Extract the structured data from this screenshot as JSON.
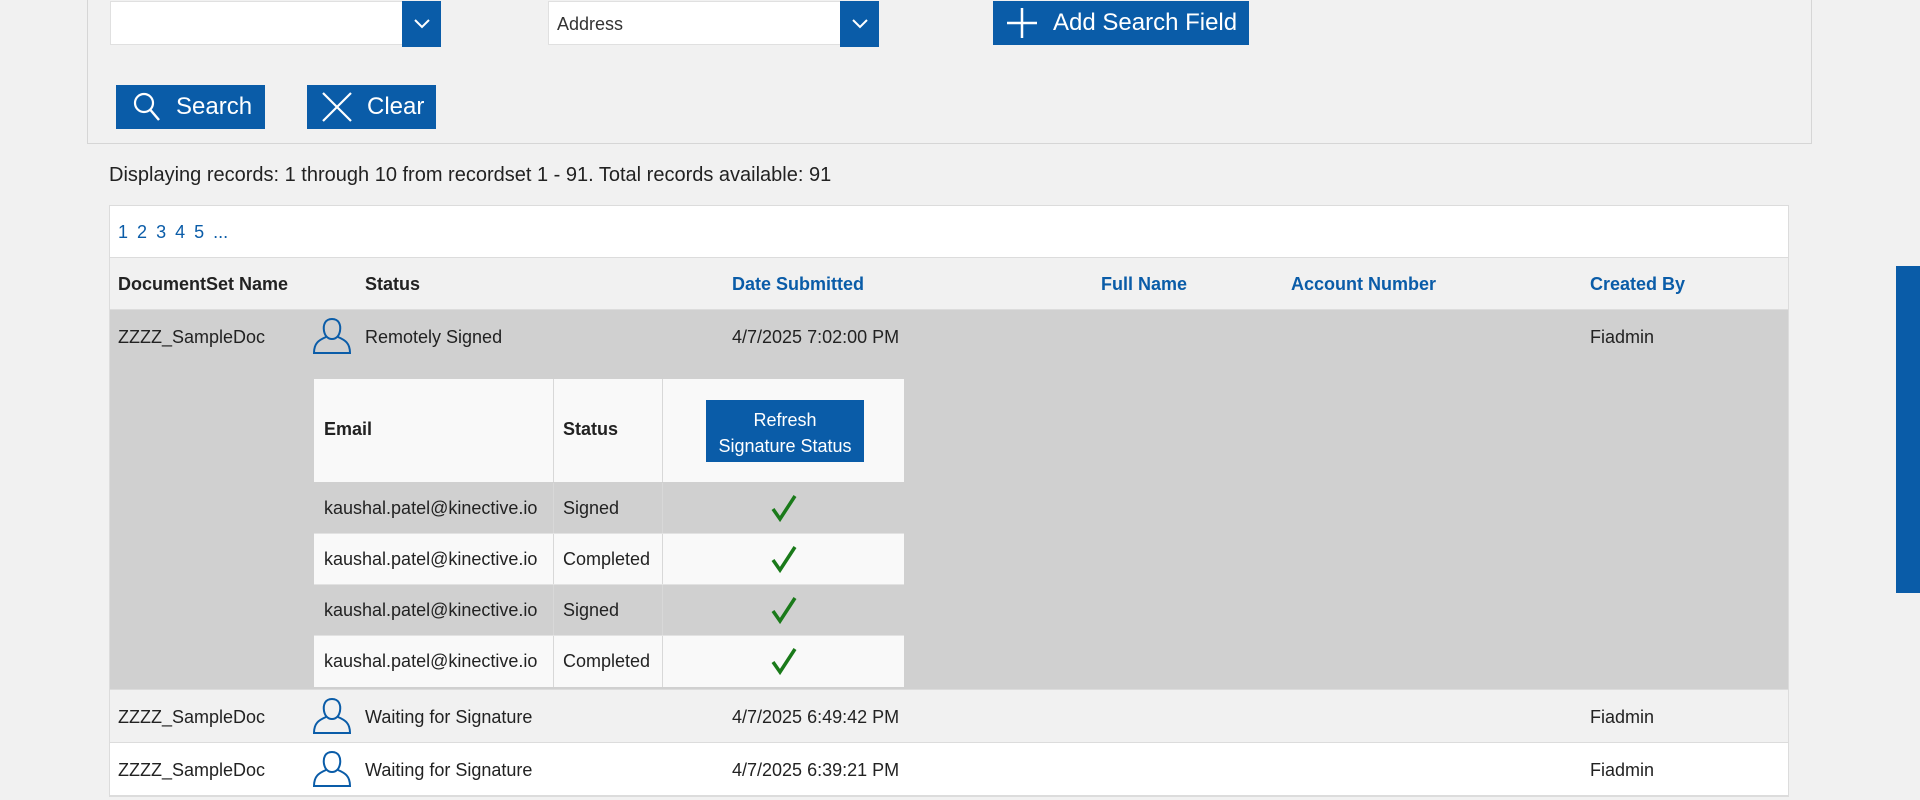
{
  "search": {
    "field1_value": "",
    "field2_value": "Address",
    "add_field_label": "Add Search Field",
    "search_label": "Search",
    "clear_label": "Clear"
  },
  "records_info": "Displaying records: 1 through 10 from recordset 1 - 91. Total records available: 91",
  "pager": {
    "current": "1",
    "pages": [
      "2",
      "3",
      "4",
      "5"
    ],
    "more": "..."
  },
  "columns": {
    "name": "DocumentSet Name",
    "status": "Status",
    "date": "Date Submitted",
    "full_name": "Full Name",
    "account": "Account Number",
    "created_by": "Created By"
  },
  "rows": [
    {
      "name": "ZZZZ_SampleDoc",
      "status": "Remotely Signed",
      "date": "4/7/2025 7:02:00 PM",
      "full_name": "",
      "account": "",
      "created_by": "Fiadmin"
    },
    {
      "name": "ZZZZ_SampleDoc",
      "status": "Waiting for Signature",
      "date": "4/7/2025 6:49:42 PM",
      "full_name": "",
      "account": "",
      "created_by": "Fiadmin"
    },
    {
      "name": "ZZZZ_SampleDoc",
      "status": "Waiting for Signature",
      "date": "4/7/2025 6:39:21 PM",
      "full_name": "",
      "account": "",
      "created_by": "Fiadmin"
    }
  ],
  "signers": {
    "email_header": "Email",
    "status_header": "Status",
    "refresh_line1": "Refresh",
    "refresh_line2": "Signature Status",
    "items": [
      {
        "email": "kaushal.patel@kinective.io",
        "status": "Signed"
      },
      {
        "email": "kaushal.patel@kinective.io",
        "status": "Completed"
      },
      {
        "email": "kaushal.patel@kinective.io",
        "status": "Signed"
      },
      {
        "email": "kaushal.patel@kinective.io",
        "status": "Completed"
      }
    ]
  },
  "colors": {
    "primary": "#0a5ca8",
    "check": "#1a7a1a",
    "row_expanded": "#d0d0d0"
  }
}
